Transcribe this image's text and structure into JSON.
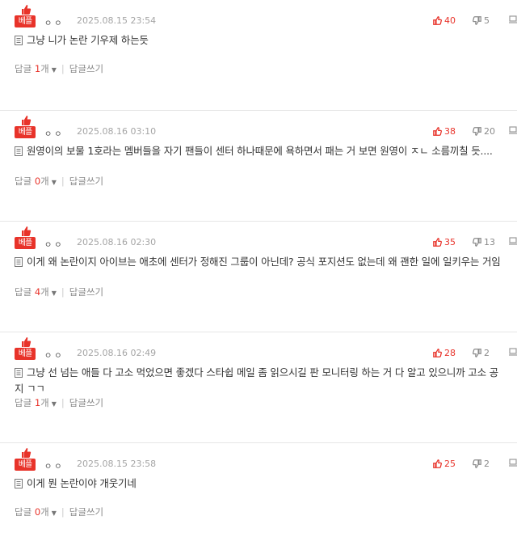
{
  "badge_label": "베플",
  "reply_label": "답글",
  "reply_unit": "개",
  "write_reply_label": "답글쓰기",
  "accent_color": "#e8332a",
  "comments": [
    {
      "nick": "ㅇㅇ",
      "date": "2025.08.15 23:54",
      "up": "40",
      "down": "5",
      "text": "그냥 니가 논란 기우제 하는듯",
      "replies": "1"
    },
    {
      "nick": "ㅇㅇ",
      "date": "2025.08.16 03:10",
      "up": "38",
      "down": "20",
      "text": "원영이의 보물 1호라는 멤버들을 자기 팬들이 센터 하나때문에 욕하면서 패는 거 보면 원영이 ㅈㄴ 소름끼칠 듯....",
      "replies": "0"
    },
    {
      "nick": "ㅇㅇ",
      "date": "2025.08.16 02:30",
      "up": "35",
      "down": "13",
      "text": "이게 왜 논란이지 아이브는 애초에 센터가 정해진 그룹이 아닌데? 공식 포지션도 없는데 왜 괜한 일에 일키우는 거임",
      "replies": "4"
    },
    {
      "nick": "ㅇㅇ",
      "date": "2025.08.16 02:49",
      "up": "28",
      "down": "2",
      "text": "그냥 선 넘는 애들 다 고소 먹었으면 좋겠다 스타쉽 메일 좀 읽으시길 판 모니터링 하는 거 다 알고 있으니까 고소 공지 ㄱㄱ",
      "replies": "1"
    },
    {
      "nick": "ㅇㅇ",
      "date": "2025.08.15 23:58",
      "up": "25",
      "down": "2",
      "text": "이게 뭔 논란이야 개웃기네",
      "replies": "0"
    }
  ]
}
